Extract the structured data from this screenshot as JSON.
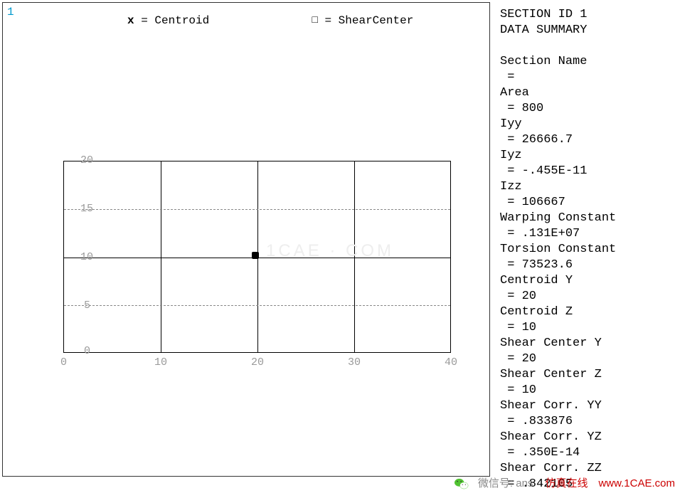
{
  "window_number": "1",
  "legend": {
    "centroid_marker": "x",
    "centroid_label": "= Centroid",
    "shear_marker": "□",
    "shear_label": "= ShearCenter"
  },
  "chart_data": {
    "type": "scatter",
    "title": "",
    "xlabel": "",
    "ylabel": "",
    "xlim": [
      0,
      40
    ],
    "ylim": [
      0,
      20
    ],
    "x_ticks": [
      0,
      10,
      20,
      30,
      40
    ],
    "y_ticks": [
      0,
      5,
      10,
      15,
      20
    ],
    "grid_x": [
      10,
      20,
      30
    ],
    "grid_y_solid": [
      10
    ],
    "grid_y_dashed": [
      5,
      15
    ],
    "series": [
      {
        "name": "Centroid",
        "x": [
          20
        ],
        "y": [
          10
        ]
      },
      {
        "name": "ShearCenter",
        "x": [
          20
        ],
        "y": [
          10
        ]
      }
    ]
  },
  "yticks": {
    "t20": "20",
    "t15": "15",
    "t10": "10",
    "t5": "5",
    "t0": "0"
  },
  "xticks": {
    "t0": "0",
    "t10": "10",
    "t20": "20",
    "t30": "30",
    "t40": "40"
  },
  "summary": {
    "title1": "SECTION ID 1",
    "title2": "DATA SUMMARY",
    "name_label": "Section Name",
    "name_value": " =",
    "area_label": "Area",
    "area_value": " = 800",
    "iyy_label": "Iyy",
    "iyy_value": " = 26666.7",
    "iyz_label": "Iyz",
    "iyz_value": " = -.455E-11",
    "izz_label": "Izz",
    "izz_value": " = 106667",
    "warp_label": "Warping Constant",
    "warp_value": " = .131E+07",
    "tors_label": "Torsion Constant",
    "tors_value": " = 73523.6",
    "cy_label": "Centroid Y",
    "cy_value": " = 20",
    "cz_label": "Centroid Z",
    "cz_value": " = 10",
    "scy_label": "Shear Center Y",
    "scy_value": " = 20",
    "scz_label": "Shear Center Z",
    "scz_value": " = 10",
    "syy_label": "Shear Corr. YY",
    "syy_value": " = .833876",
    "syz_label": "Shear Corr. YZ",
    "syz_value": " = .350E-14",
    "szz_label": "Shear Corr. ZZ",
    "szz_value": " = .842105"
  },
  "watermark": "1CAE · COM",
  "footer": {
    "wechat_label": "微信号: ans",
    "sim_text": "仿真在线",
    "url": "www.1CAE.com"
  }
}
